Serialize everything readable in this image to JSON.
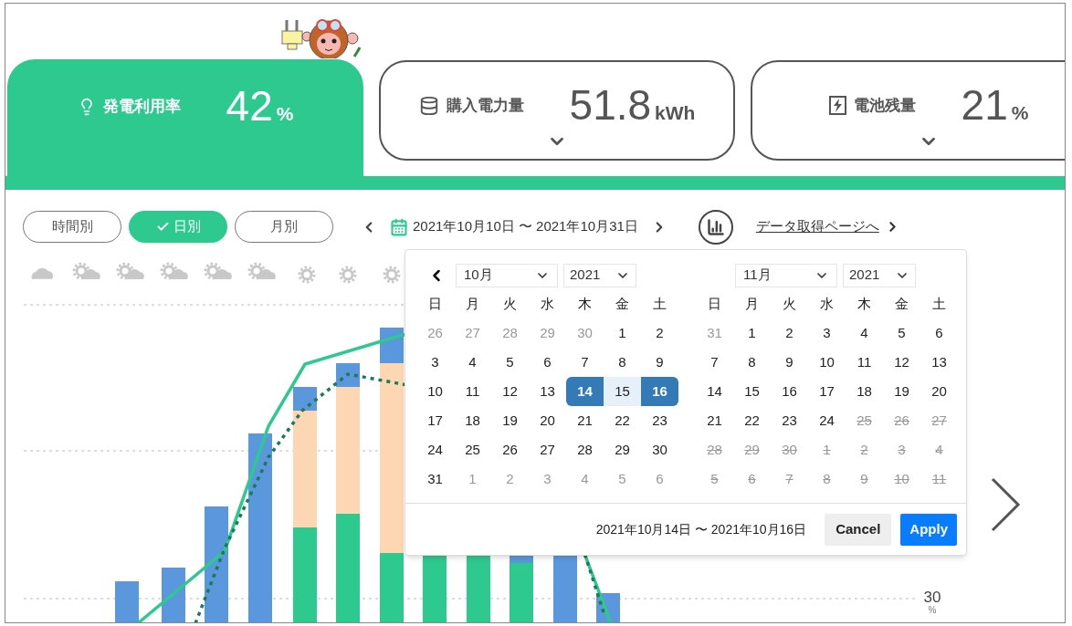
{
  "tabs": [
    {
      "label": "発電利用率",
      "value": "42",
      "unit": "%",
      "selected": true
    },
    {
      "label": "購入電力量",
      "value": "51.8",
      "unit": "kWh",
      "selected": false
    },
    {
      "label": "電池残量",
      "value": "21",
      "unit": "%",
      "selected": false
    }
  ],
  "period_buttons": [
    {
      "label": "時間別",
      "selected": false
    },
    {
      "label": "日別",
      "selected": true
    },
    {
      "label": "月別",
      "selected": false
    }
  ],
  "date_range": "2021年10月10日 〜 2021年10月31日",
  "data_link": "データ取得ページへ",
  "weather": [
    {
      "kind": "cloudy"
    },
    {
      "kind": "partly_cloudy"
    },
    {
      "kind": "partly_cloudy"
    },
    {
      "kind": "partly_cloudy"
    },
    {
      "kind": "partly_cloudy"
    },
    {
      "kind": "partly_cloudy"
    },
    {
      "kind": "sunny"
    },
    {
      "kind": "sunny"
    },
    {
      "kind": "sunny"
    }
  ],
  "axis_label": {
    "value": "30",
    "unit": "%"
  },
  "date_picker": {
    "calendars": [
      {
        "month": "10月",
        "year": "2021",
        "prev_arrow": true,
        "weekdays": [
          "日",
          "月",
          "火",
          "水",
          "木",
          "金",
          "土"
        ],
        "weeks": [
          {
            "days": [
              {
                "text": "26",
                "kind": "outside",
                "selected": false
              },
              {
                "text": "27",
                "kind": "outside",
                "selected": false
              },
              {
                "text": "28",
                "kind": "outside",
                "selected": false
              },
              {
                "text": "29",
                "kind": "outside",
                "selected": false
              },
              {
                "text": "30",
                "kind": "outside",
                "selected": false
              },
              {
                "text": "1",
                "kind": "current",
                "selected": false
              },
              {
                "text": "2",
                "kind": "current",
                "selected": false
              }
            ]
          },
          {
            "days": [
              {
                "text": "3",
                "kind": "current",
                "selected": false
              },
              {
                "text": "4",
                "kind": "current",
                "selected": false
              },
              {
                "text": "5",
                "kind": "current",
                "selected": false
              },
              {
                "text": "6",
                "kind": "current",
                "selected": false
              },
              {
                "text": "7",
                "kind": "current",
                "selected": false
              },
              {
                "text": "8",
                "kind": "current",
                "selected": false
              },
              {
                "text": "9",
                "kind": "current",
                "selected": false
              }
            ]
          },
          {
            "days": [
              {
                "text": "10",
                "kind": "current",
                "selected": false
              },
              {
                "text": "11",
                "kind": "current",
                "selected": false
              },
              {
                "text": "12",
                "kind": "current",
                "selected": false
              },
              {
                "text": "13",
                "kind": "current",
                "selected": false
              },
              {
                "text": "14",
                "kind": "current",
                "selected": true
              },
              {
                "text": "15",
                "kind": "in_range",
                "selected": false
              },
              {
                "text": "16",
                "kind": "current",
                "selected": true
              }
            ]
          },
          {
            "days": [
              {
                "text": "17",
                "kind": "current",
                "selected": false
              },
              {
                "text": "18",
                "kind": "current",
                "selected": false
              },
              {
                "text": "19",
                "kind": "current",
                "selected": false
              },
              {
                "text": "20",
                "kind": "current",
                "selected": false
              },
              {
                "text": "21",
                "kind": "current",
                "selected": false
              },
              {
                "text": "22",
                "kind": "current",
                "selected": false
              },
              {
                "text": "23",
                "kind": "current",
                "selected": false
              }
            ]
          },
          {
            "days": [
              {
                "text": "24",
                "kind": "current",
                "selected": false
              },
              {
                "text": "25",
                "kind": "current",
                "selected": false
              },
              {
                "text": "26",
                "kind": "current",
                "selected": false
              },
              {
                "text": "27",
                "kind": "current",
                "selected": false
              },
              {
                "text": "28",
                "kind": "current",
                "selected": false
              },
              {
                "text": "29",
                "kind": "current",
                "selected": false
              },
              {
                "text": "30",
                "kind": "current",
                "selected": false
              }
            ]
          },
          {
            "days": [
              {
                "text": "31",
                "kind": "current",
                "selected": false
              },
              {
                "text": "1",
                "kind": "outside",
                "selected": false
              },
              {
                "text": "2",
                "kind": "outside",
                "selected": false
              },
              {
                "text": "3",
                "kind": "outside",
                "selected": false
              },
              {
                "text": "4",
                "kind": "outside",
                "selected": false
              },
              {
                "text": "5",
                "kind": "outside",
                "selected": false
              },
              {
                "text": "6",
                "kind": "outside",
                "selected": false
              }
            ]
          }
        ]
      },
      {
        "month": "11月",
        "year": "2021",
        "prev_arrow": false,
        "weekdays": [
          "日",
          "月",
          "火",
          "水",
          "木",
          "金",
          "土"
        ],
        "weeks": [
          {
            "days": [
              {
                "text": "31",
                "kind": "outside",
                "selected": false
              },
              {
                "text": "1",
                "kind": "current",
                "selected": false
              },
              {
                "text": "2",
                "kind": "current",
                "selected": false
              },
              {
                "text": "3",
                "kind": "current",
                "selected": false
              },
              {
                "text": "4",
                "kind": "current",
                "selected": false
              },
              {
                "text": "5",
                "kind": "current",
                "selected": false
              },
              {
                "text": "6",
                "kind": "current",
                "selected": false
              }
            ]
          },
          {
            "days": [
              {
                "text": "7",
                "kind": "current",
                "selected": false
              },
              {
                "text": "8",
                "kind": "current",
                "selected": false
              },
              {
                "text": "9",
                "kind": "current",
                "selected": false
              },
              {
                "text": "10",
                "kind": "current",
                "selected": false
              },
              {
                "text": "11",
                "kind": "current",
                "selected": false
              },
              {
                "text": "12",
                "kind": "current",
                "selected": false
              },
              {
                "text": "13",
                "kind": "current",
                "selected": false
              }
            ]
          },
          {
            "days": [
              {
                "text": "14",
                "kind": "current",
                "selected": false
              },
              {
                "text": "15",
                "kind": "current",
                "selected": false
              },
              {
                "text": "16",
                "kind": "current",
                "selected": false
              },
              {
                "text": "17",
                "kind": "current",
                "selected": false
              },
              {
                "text": "18",
                "kind": "current",
                "selected": false
              },
              {
                "text": "19",
                "kind": "current",
                "selected": false
              },
              {
                "text": "20",
                "kind": "current",
                "selected": false
              }
            ]
          },
          {
            "days": [
              {
                "text": "21",
                "kind": "current",
                "selected": false
              },
              {
                "text": "22",
                "kind": "current",
                "selected": false
              },
              {
                "text": "23",
                "kind": "current",
                "selected": false
              },
              {
                "text": "24",
                "kind": "current",
                "selected": false
              },
              {
                "text": "25",
                "kind": "disabled",
                "selected": false
              },
              {
                "text": "26",
                "kind": "disabled",
                "selected": false
              },
              {
                "text": "27",
                "kind": "disabled",
                "selected": false
              }
            ]
          },
          {
            "days": [
              {
                "text": "28",
                "kind": "disabled",
                "selected": false
              },
              {
                "text": "29",
                "kind": "disabled",
                "selected": false
              },
              {
                "text": "30",
                "kind": "disabled",
                "selected": false
              },
              {
                "text": "1",
                "kind": "disabled",
                "selected": false
              },
              {
                "text": "2",
                "kind": "disabled",
                "selected": false
              },
              {
                "text": "3",
                "kind": "disabled",
                "selected": false
              },
              {
                "text": "4",
                "kind": "disabled",
                "selected": false
              }
            ]
          },
          {
            "days": [
              {
                "text": "5",
                "kind": "disabled",
                "selected": false
              },
              {
                "text": "6",
                "kind": "disabled",
                "selected": false
              },
              {
                "text": "7",
                "kind": "disabled",
                "selected": false
              },
              {
                "text": "8",
                "kind": "disabled",
                "selected": false
              },
              {
                "text": "9",
                "kind": "disabled",
                "selected": false
              },
              {
                "text": "10",
                "kind": "disabled",
                "selected": false
              },
              {
                "text": "11",
                "kind": "disabled",
                "selected": false
              }
            ]
          }
        ]
      }
    ],
    "selected_range": "2021年10月14日 〜 2021年10月16日",
    "buttons": [
      {
        "label": "Cancel",
        "kind": "secondary"
      },
      {
        "label": "Apply",
        "kind": "primary"
      }
    ]
  }
}
